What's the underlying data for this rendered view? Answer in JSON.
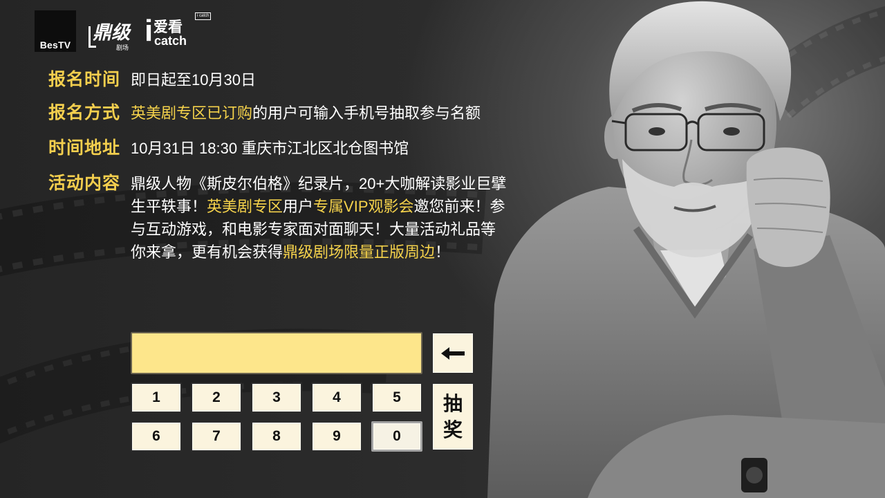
{
  "logos": {
    "bestv": {
      "text": "BesTV"
    },
    "dingji": {
      "main": "鼎级",
      "sub": "剧场"
    },
    "icatch": {
      "i": "i",
      "cn": "爱看",
      "en": "catch",
      "badge": "i catch"
    }
  },
  "info": [
    {
      "label": "报名时间",
      "lines": [
        [
          {
            "text": "即日起至10月30日",
            "highlight": false
          }
        ]
      ]
    },
    {
      "label": "报名方式",
      "lines": [
        [
          {
            "text": "英美剧专区已订购",
            "highlight": true
          },
          {
            "text": "的用户可输入手机号抽取参与名额",
            "highlight": false
          }
        ]
      ]
    },
    {
      "label": "时间地址",
      "lines": [
        [
          {
            "text": "10月31日 18:30 重庆市江北区北仓图书馆",
            "highlight": false
          }
        ]
      ]
    },
    {
      "label": "活动内容",
      "lines": [
        [
          {
            "text": "鼎级人物《斯皮尔伯格》纪录片，20+大咖解读影业巨擘",
            "highlight": false
          }
        ],
        [
          {
            "text": "生平轶事！",
            "highlight": false
          },
          {
            "text": "英美剧专区",
            "highlight": true
          },
          {
            "text": "用户",
            "highlight": false
          },
          {
            "text": "专属VIP观影会",
            "highlight": true
          },
          {
            "text": "邀您前来！参",
            "highlight": false
          }
        ],
        [
          {
            "text": "与互动游戏，和电影专家面对面聊天！大量活动礼品等",
            "highlight": false
          }
        ],
        [
          {
            "text": "你来拿，更有机会获得",
            "highlight": false
          },
          {
            "text": "鼎级剧场限量正版周边",
            "highlight": true
          },
          {
            "text": "！",
            "highlight": false
          }
        ]
      ]
    }
  ],
  "keypad": {
    "phone_input": {
      "value": ""
    },
    "keys": [
      "1",
      "2",
      "3",
      "4",
      "5",
      "6",
      "7",
      "8",
      "9",
      "0"
    ],
    "focused_key": "0",
    "draw_label": "抽奖"
  },
  "icons": {
    "backspace": "backspace-arrow-icon"
  },
  "colors": {
    "background": "#262626",
    "label": "#f4cf4e",
    "highlight": "#f5d24b",
    "body_text": "#ffffff",
    "input_fill": "#fde68b",
    "key_fill": "#fbf4de",
    "key_border": "#2c2c2c",
    "key_text": "#111111"
  }
}
